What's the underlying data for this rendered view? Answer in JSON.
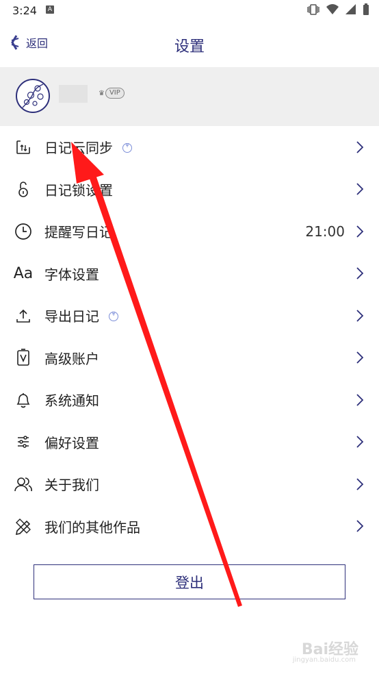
{
  "status_bar": {
    "time": "3:24",
    "notification_icon": "A"
  },
  "header": {
    "back_label": "返回",
    "title": "设置"
  },
  "profile": {
    "vip_label": "VIP"
  },
  "menu": [
    {
      "label": "日记云同步",
      "icon": "cloud-sync-icon",
      "coin": true
    },
    {
      "label": "日记锁设置",
      "icon": "lock-icon"
    },
    {
      "label": "提醒写日记",
      "icon": "clock-icon",
      "value": "21:00"
    },
    {
      "label": "字体设置",
      "icon": "font-icon",
      "glyph": "Aa"
    },
    {
      "label": "导出日记",
      "icon": "export-icon",
      "coin": true
    },
    {
      "label": "高级账户",
      "icon": "premium-account-icon"
    },
    {
      "label": "系统通知",
      "icon": "bell-icon"
    },
    {
      "label": "偏好设置",
      "icon": "sliders-icon"
    },
    {
      "label": "关于我们",
      "icon": "people-icon"
    },
    {
      "label": "我们的其他作品",
      "icon": "tools-icon"
    }
  ],
  "logout": {
    "label": "登出"
  },
  "watermark": {
    "text": "Bai经验",
    "sub": "jingyan.baidu.com"
  },
  "colors": {
    "accent": "#2d2f7a",
    "profile_bg": "#efefef",
    "arrow": "#ff1a1a"
  }
}
